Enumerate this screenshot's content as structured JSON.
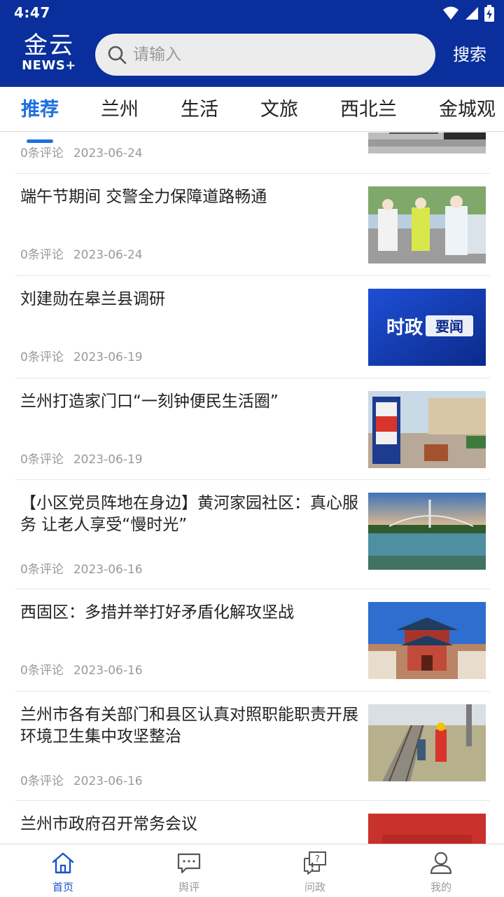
{
  "status_bar": {
    "time": "4:47"
  },
  "header": {
    "logo_cn": "金云",
    "logo_en": "NEWS+",
    "search_placeholder": "请输入",
    "search_button": "搜索"
  },
  "tabs": [
    {
      "label": "推荐",
      "active": true
    },
    {
      "label": "兰州",
      "active": false
    },
    {
      "label": "生活",
      "active": false
    },
    {
      "label": "文旅",
      "active": false
    },
    {
      "label": "西北兰",
      "active": false
    },
    {
      "label": "金城观",
      "active": false
    }
  ],
  "news": [
    {
      "title": "",
      "comments": "0条评论",
      "date": "2023-06-24",
      "image": "office-desk-photo"
    },
    {
      "title": "端午节期间 交警全力保障道路畅通",
      "comments": "0条评论",
      "date": "2023-06-24",
      "image": "traffic-police-photo"
    },
    {
      "title": "刘建勋在皋兰县调研",
      "comments": "0条评论",
      "date": "2023-06-19",
      "image": "politics-news-banner",
      "image_text": "时政要闻"
    },
    {
      "title": "兰州打造家门口“一刻钟便民生活圈”",
      "comments": "0条评论",
      "date": "2023-06-19",
      "image": "street-plaza-photo"
    },
    {
      "title": "【小区党员阵地在身边】黄河家园社区：真心服务 让老人享受“慢时光”",
      "comments": "0条评论",
      "date": "2023-06-16",
      "image": "river-bridge-photo"
    },
    {
      "title": "西固区：多措并举打好矛盾化解攻坚战",
      "comments": "0条评论",
      "date": "2023-06-16",
      "image": "pavilion-photo"
    },
    {
      "title": "兰州市各有关部门和县区认真对照职能职责开展环境卫生集中攻坚整治",
      "comments": "0条评论",
      "date": "2023-06-16",
      "image": "railway-cleanup-photo"
    },
    {
      "title": "兰州市政府召开常务会议",
      "comments": "",
      "date": "",
      "image": "red-banner-photo"
    }
  ],
  "bottom_nav": [
    {
      "label": "首页",
      "icon": "home-icon",
      "active": true
    },
    {
      "label": "舆评",
      "icon": "chat-icon",
      "active": false
    },
    {
      "label": "问政",
      "icon": "question-icon",
      "active": false
    },
    {
      "label": "我的",
      "icon": "user-icon",
      "active": false
    }
  ],
  "colors": {
    "header_bg": "#0a2f9c",
    "accent": "#1e6fe0",
    "nav_active": "#1552c6"
  }
}
